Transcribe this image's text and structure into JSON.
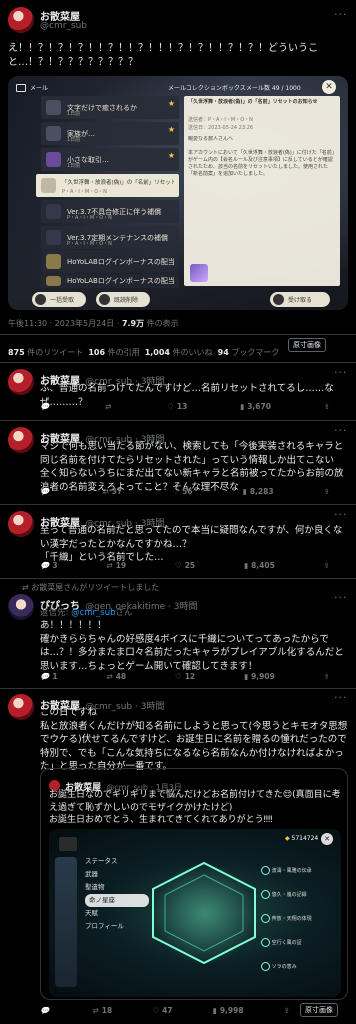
{
  "main": {
    "name": "お散菜屋",
    "handle": "@cmr_sub",
    "text": "え！！？！？！？！！？！！？！！！？！？！！？！？！どういうこと…！？！？？？？？？？？",
    "time": "午後11:30 · 2023年5月24日 · ",
    "views": "7.9万",
    "views_label": " 件の表示",
    "stats": [
      {
        "num": "875",
        "label": " 件のリツイート"
      },
      {
        "num": "106",
        "label": " 件の引用"
      },
      {
        "num": "1,004",
        "label": " 件のいいね"
      },
      {
        "num": "94",
        "label": " ブックマーク"
      }
    ],
    "source_button": "原寸画像"
  },
  "game_shot": {
    "tab_mail": "メール",
    "tab_collection": "メールコレクションボックス",
    "mail_count": "メール数 49 / 1000",
    "mails": [
      {
        "title": "文字だけで癒されるか",
        "sub": "1日前",
        "meta": "期限：1日"
      },
      {
        "title": "家族が…",
        "sub": "1日前",
        "meta": ""
      },
      {
        "title": "小さな取引…",
        "sub": "1日前",
        "meta": ""
      },
      {
        "title": "「久世浮舞・放浪者(偽)」の「名前」リセットのお知らせ",
        "sub": "P・A・I・M・O・N",
        "meta": ""
      },
      {
        "title": "Ver.3.7不具合修正に伴う補償",
        "sub": "P・A・I・M・O・N",
        "meta": ""
      },
      {
        "title": "Ver.3.7定期メンテナンスの補償",
        "sub": "P・A・I・M・O・N",
        "meta": ""
      },
      {
        "title": "HoYoLABログインボーナスの配当",
        "sub": "",
        "meta": ""
      },
      {
        "title": "HoYoLABログインボーナスの配当",
        "sub": "",
        "meta": ""
      }
    ],
    "detail_title": "「久世浮舞・放浪者(偽)」の「名前」リセットのお知らせ",
    "detail_from": "送信者：P・A・I・M・O・N",
    "detail_date": "送信日：2023-05-24 23:26",
    "detail_body": "親愛なる旅人さんへ\n\n本アカウントにおいて「久世浮舞・放浪者(偽)」に付けた「名前」がゲーム内の【会名ルール及び注意事項】に反しているとが確認されたため、該当の名前をリセットいたしました。使用された「新名前案」を追加いたしました。",
    "btn_collect_all": "一括受取",
    "btn_delete_read": "既読削除",
    "btn_receive": "受け取る"
  },
  "replies": [
    {
      "name": "お散菜屋",
      "handle": "@cmr_sub · 3時間",
      "text": "ふ、普通の名前つけてたんですけど…名前リセットされてるし……なぜ………？",
      "reply": "",
      "retweet": "",
      "like": "13",
      "views": "3,670"
    },
    {
      "name": "お散菜屋",
      "handle": "@cmr_sub · 3時間",
      "text": "マジで何も思い当たる節がない、検索しても「今後実装されるキャラと同じ名前を付けてたらリセットされた」っていう情報しか出てこない\n全く知らないうちにまだ出てない新キャラと名前被ってたからお前の放浪者の名前変えろよってこと？そんな理不尽な",
      "reply": "",
      "retweet": "37",
      "like": "56",
      "views": "8,283"
    },
    {
      "name": "お散菜屋",
      "handle": "@cmr_sub · 3時間",
      "text": "至って普通の名前だと思ってたので本当に疑問なんですが、何か良くない漢字だったとかなんですかね…？\n「千織」という名前でした…",
      "reply": "3",
      "retweet": "19",
      "like": "25",
      "views": "8,405"
    }
  ],
  "retweet_note": "お散菜屋さんがリツイートしました",
  "quote_reply": {
    "name": "ぴぴっち",
    "handle": "@gen_oekakitime · 3時間",
    "reply_to_label": "返信先: ",
    "reply_to": "@cmr_sub",
    "reply_to_suffix": "さん",
    "text": "あ！！！！！！\n確かきららちゃんの好感度4ボイスに千織についてってあったからでは…？！多分またま口々名前だったキャラがプレイアブル化するんだと思います…ちょっとゲーム開いて確認してきます！",
    "reply": "1",
    "retweet": "48",
    "like": "12",
    "views": "9,909"
  },
  "last": {
    "name": "お散菜屋",
    "handle": "@cmr_sub · 3時間",
    "text": "この日ですね\n私と放浪者くんだけが知る名前にしようと思って(今思うとキモオタ思想でウケる)伏せてるんですけど、お誕生日に名前を贈るの憧れだったので特別で、でも「こんな気持ちになるなら名前なんか付けなければよかった」と思った自分が一番です。",
    "quote": {
      "name": "お散菜屋",
      "handle": "@cmr_sub · 1月3日",
      "text": "お誕生日なのでギリギリまで悩んだけどお名前付けてきた😌(真面目に考え過ぎて恥ずかしいのでモザイクかけたけど)\nお誕生日おめでとう、生まれてきてくれてありがとう‼‼",
      "menu": [
        "ステータス",
        "武器",
        "聖遺物",
        "命ノ星座",
        "天賦",
        "プロフィール"
      ],
      "primo": "5714724",
      "right_items": [
        "波濤・風雅の伝承",
        "悠久・嵐の記録",
        "奔放・天翔の体現",
        "空行く風の証",
        "ソラの恵み"
      ]
    },
    "reply": "",
    "retweet": "18",
    "like": "47",
    "views": "9,998",
    "source_button": "原寸画像"
  }
}
